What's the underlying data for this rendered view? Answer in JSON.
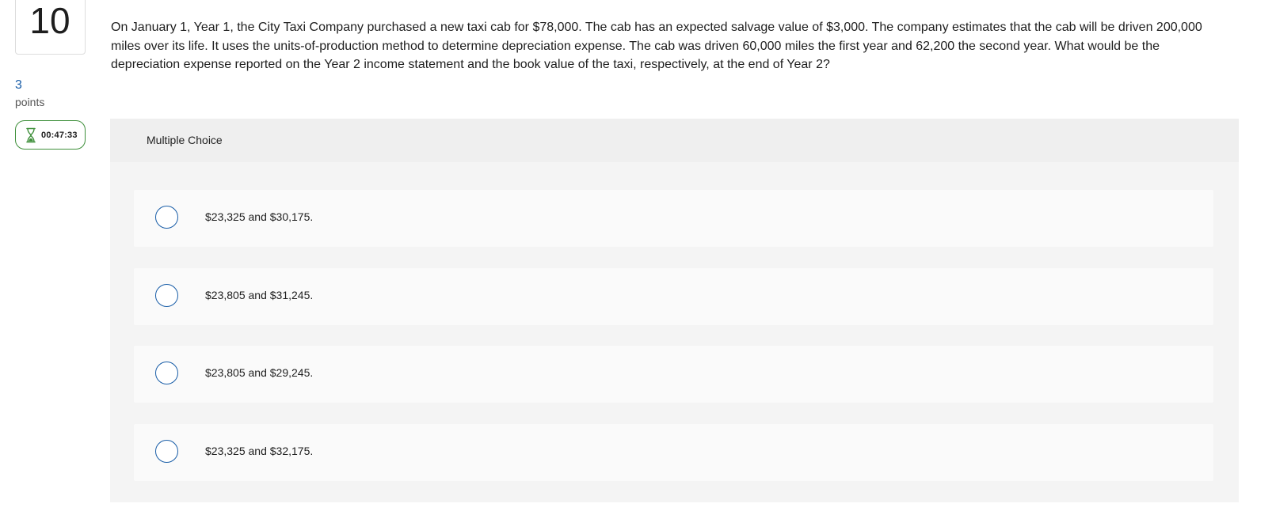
{
  "question": {
    "number": "10",
    "points_value": "3",
    "points_label": "points",
    "timer": "00:47:33",
    "text": "On January 1, Year 1, the City Taxi Company purchased a new taxi cab for $78,000. The cab has an expected salvage value of $3,000. The company estimates that the cab will be driven 200,000 miles over its life. It uses the units-of-production method to determine depreciation expense. The cab was driven 60,000 miles the first year and 62,200 the second year. What would be the depreciation expense reported on the Year 2 income statement and the book value of the taxi, respectively, at the end of Year 2?"
  },
  "choices": {
    "header": "Multiple Choice",
    "options": [
      {
        "label": "$23,325 and $30,175."
      },
      {
        "label": "$23,805 and $31,245."
      },
      {
        "label": "$23,805 and $29,245."
      },
      {
        "label": "$23,325 and $32,175."
      }
    ]
  },
  "colors": {
    "accent_blue": "#1a5ea8",
    "timer_green": "#3e8f3a"
  },
  "icons": {
    "timer": "hourglass-icon",
    "radio": "radio-button-icon"
  }
}
